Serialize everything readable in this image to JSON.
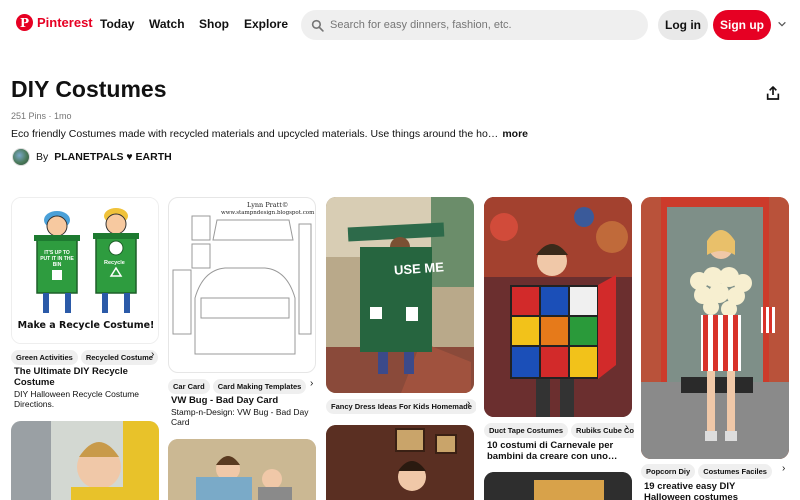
{
  "header": {
    "brand": "Pinterest",
    "nav": [
      "Today",
      "Watch",
      "Shop",
      "Explore"
    ],
    "search_placeholder": "Search for easy dinners, fashion, etc.",
    "login_label": "Log in",
    "signup_label": "Sign up"
  },
  "board": {
    "title": "DIY Costumes",
    "meta": "251 Pins · 1mo",
    "description": "Eco friendly Costumes made with recycled materials and upcycled materials. Use things around the ho…",
    "more_label": "more",
    "by_label": "By",
    "owner": "PLANETPALS ♥ EARTH"
  },
  "pins": [
    {
      "image_text": "Make a Recycle Costume!",
      "bin_text_left": "IT'S UP TO PUT IT IN THE BIN",
      "bin_text_right": "Recycle",
      "chips": [
        "Green Activities",
        "Recycled Costume"
      ],
      "title": "The Ultimate DIY Recycle Costume",
      "description": "DIY Halloween Recycle Costume Directions."
    },
    {
      "image_text_1": "Lynn Pratt©",
      "image_text_2": "www.stampndesign.blogspot.com",
      "chips": [
        "Car Card",
        "Card Making Templates"
      ],
      "title": "VW Bug - Bad Day Card",
      "description": "Stamp-n-Design: VW Bug - Bad Day Card"
    },
    {
      "image_text": "USE ME",
      "chips": [
        "Fancy Dress Ideas For Kids Homemade"
      ]
    },
    {
      "chips": [
        "Duct Tape Costumes",
        "Rubiks Cube Costume"
      ],
      "title": "10 costumi di Carnevale per bambini da creare con uno…"
    },
    {
      "chips": [
        "Popcorn Diy",
        "Costumes Faciles"
      ],
      "title": "19 creative easy DIY Halloween costumes"
    }
  ],
  "colors": {
    "brand_red": "#e60023",
    "chip_bg": "#efefef",
    "search_bg": "#efefef"
  }
}
